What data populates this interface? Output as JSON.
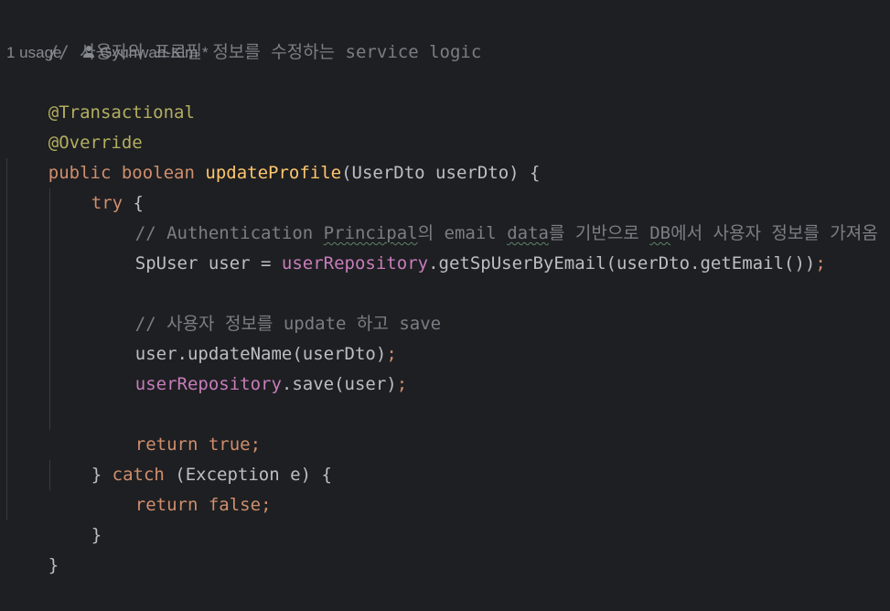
{
  "editor": {
    "header_comment": "// 사용자의 프로필 정보를 수정하는 service logic",
    "inlay": {
      "usages": "1 usage",
      "author": "Gyuhwan-Kim *"
    },
    "lines": {
      "ann1": "@Transactional",
      "ann2": "@Override",
      "sig_public": "public",
      "sig_boolean": "boolean",
      "sig_name": "updateProfile",
      "sig_params": "(UserDto userDto) {",
      "try_kw": "try",
      "try_brace": " {",
      "c1_pre": "// Authentication ",
      "c1_principal": "Principal",
      "c1_mid": "의 email ",
      "c1_data": "data",
      "c1_post": "를 기반으로 ",
      "c1_db": "DB",
      "c1_end": "에서 사용자 정보를 가져옴",
      "l1_decl": "SpUser user = ",
      "l1_field": "userRepository",
      "l1_call": ".getSpUserByEmail(userDto.getEmail())",
      "semi": ";",
      "c2": "// 사용자 정보를 update 하고 save",
      "l2_call": "user.updateName(userDto)",
      "l3_field": "userRepository",
      "l3_call": ".save(user)",
      "ret_kw": "return",
      "ret_true": "true",
      "catch_open": "} ",
      "catch_kw": "catch",
      "catch_params": " (Exception e) {",
      "ret_false": "false",
      "close_inner": "}",
      "close_outer": "}"
    }
  }
}
